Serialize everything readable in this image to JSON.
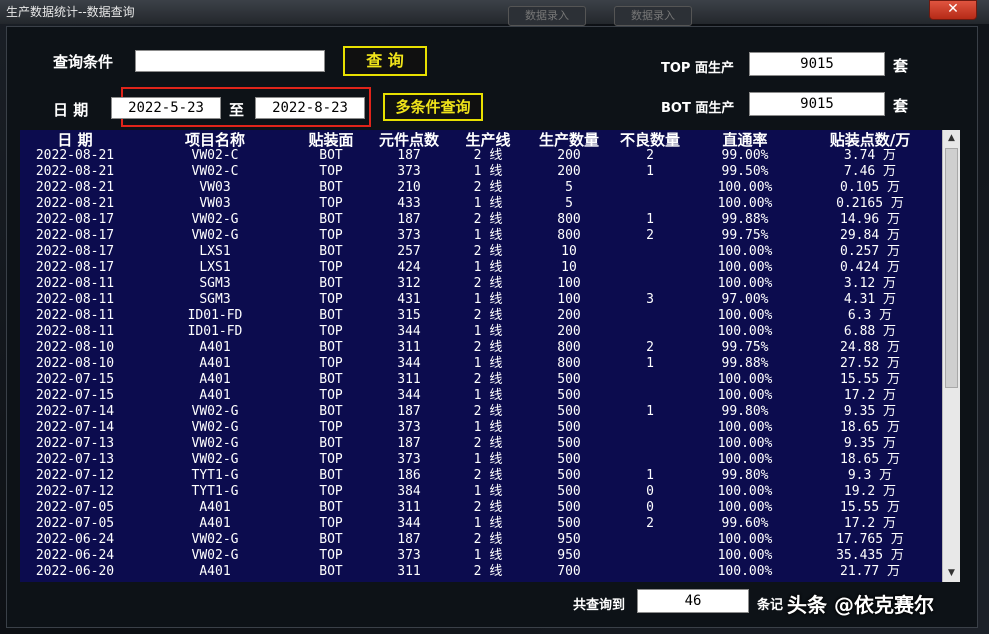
{
  "window": {
    "title": "生产数据统计--数据查询",
    "close_label": "✕",
    "ghost_buttons": [
      "数据录入",
      "数据录入"
    ]
  },
  "query": {
    "label": "查询条件",
    "value": "",
    "button": "查 询"
  },
  "date": {
    "label": "日 期",
    "from": "2022-5-23",
    "sep": "至",
    "to": "2022-8-23",
    "multi_button": "多条件查询"
  },
  "top_prod": {
    "label": "TOP 面生产",
    "value": "9015",
    "unit": "套"
  },
  "bot_prod": {
    "label": "BOT 面生产",
    "value": "9015",
    "unit": "套"
  },
  "table": {
    "headers": [
      "日 期",
      "项目名称",
      "贴装面",
      "元件点数",
      "生产线",
      "生产数量",
      "不良数量",
      "直通率",
      "贴装点数/万"
    ],
    "rows": [
      [
        "2022-08-21",
        "VW02-C",
        "BOT",
        "187",
        "2 线",
        "200",
        "2",
        "99.00%",
        "3.74 万"
      ],
      [
        "2022-08-21",
        "VW02-C",
        "TOP",
        "373",
        "1 线",
        "200",
        "1",
        "99.50%",
        "7.46 万"
      ],
      [
        "2022-08-21",
        "VW03",
        "BOT",
        "210",
        "2 线",
        "5",
        "",
        "100.00%",
        "0.105 万"
      ],
      [
        "2022-08-21",
        "VW03",
        "TOP",
        "433",
        "1 线",
        "5",
        "",
        "100.00%",
        "0.2165 万"
      ],
      [
        "2022-08-17",
        "VW02-G",
        "BOT",
        "187",
        "2 线",
        "800",
        "1",
        "99.88%",
        "14.96 万"
      ],
      [
        "2022-08-17",
        "VW02-G",
        "TOP",
        "373",
        "1 线",
        "800",
        "2",
        "99.75%",
        "29.84 万"
      ],
      [
        "2022-08-17",
        "LXS1",
        "BOT",
        "257",
        "2 线",
        "10",
        "",
        "100.00%",
        "0.257 万"
      ],
      [
        "2022-08-17",
        "LXS1",
        "TOP",
        "424",
        "1 线",
        "10",
        "",
        "100.00%",
        "0.424 万"
      ],
      [
        "2022-08-11",
        "SGM3",
        "BOT",
        "312",
        "2 线",
        "100",
        "",
        "100.00%",
        "3.12 万"
      ],
      [
        "2022-08-11",
        "SGM3",
        "TOP",
        "431",
        "1 线",
        "100",
        "3",
        "97.00%",
        "4.31 万"
      ],
      [
        "2022-08-11",
        "ID01-FD",
        "BOT",
        "315",
        "2 线",
        "200",
        "",
        "100.00%",
        "6.3 万"
      ],
      [
        "2022-08-11",
        "ID01-FD",
        "TOP",
        "344",
        "1 线",
        "200",
        "",
        "100.00%",
        "6.88 万"
      ],
      [
        "2022-08-10",
        "A401",
        "BOT",
        "311",
        "2 线",
        "800",
        "2",
        "99.75%",
        "24.88 万"
      ],
      [
        "2022-08-10",
        "A401",
        "TOP",
        "344",
        "1 线",
        "800",
        "1",
        "99.88%",
        "27.52 万"
      ],
      [
        "2022-07-15",
        "A401",
        "BOT",
        "311",
        "2 线",
        "500",
        "",
        "100.00%",
        "15.55 万"
      ],
      [
        "2022-07-15",
        "A401",
        "TOP",
        "344",
        "1 线",
        "500",
        "",
        "100.00%",
        "17.2 万"
      ],
      [
        "2022-07-14",
        "VW02-G",
        "BOT",
        "187",
        "2 线",
        "500",
        "1",
        "99.80%",
        "9.35 万"
      ],
      [
        "2022-07-14",
        "VW02-G",
        "TOP",
        "373",
        "1 线",
        "500",
        "",
        "100.00%",
        "18.65 万"
      ],
      [
        "2022-07-13",
        "VW02-G",
        "BOT",
        "187",
        "2 线",
        "500",
        "",
        "100.00%",
        "9.35 万"
      ],
      [
        "2022-07-13",
        "VW02-G",
        "TOP",
        "373",
        "1 线",
        "500",
        "",
        "100.00%",
        "18.65 万"
      ],
      [
        "2022-07-12",
        "TYT1-G",
        "BOT",
        "186",
        "2 线",
        "500",
        "1",
        "99.80%",
        "9.3 万"
      ],
      [
        "2022-07-12",
        "TYT1-G",
        "TOP",
        "384",
        "1 线",
        "500",
        "0",
        "100.00%",
        "19.2 万"
      ],
      [
        "2022-07-05",
        "A401",
        "BOT",
        "311",
        "2 线",
        "500",
        "0",
        "100.00%",
        "15.55 万"
      ],
      [
        "2022-07-05",
        "A401",
        "TOP",
        "344",
        "1 线",
        "500",
        "2",
        "99.60%",
        "17.2 万"
      ],
      [
        "2022-06-24",
        "VW02-G",
        "BOT",
        "187",
        "2 线",
        "950",
        "",
        "100.00%",
        "17.765 万"
      ],
      [
        "2022-06-24",
        "VW02-G",
        "TOP",
        "373",
        "1 线",
        "950",
        "",
        "100.00%",
        "35.435 万"
      ],
      [
        "2022-06-20",
        "A401",
        "BOT",
        "311",
        "2 线",
        "700",
        "",
        "100.00%",
        "21.77 万"
      ]
    ]
  },
  "footer": {
    "total_label": "共查询到",
    "total_value": "46",
    "unit": "条记"
  },
  "watermark": "头条 @依克赛尔",
  "colors": {
    "grid_bg": "#0c0c4e",
    "button_text": "#f0e41a",
    "highlight_border": "#e0241a"
  }
}
